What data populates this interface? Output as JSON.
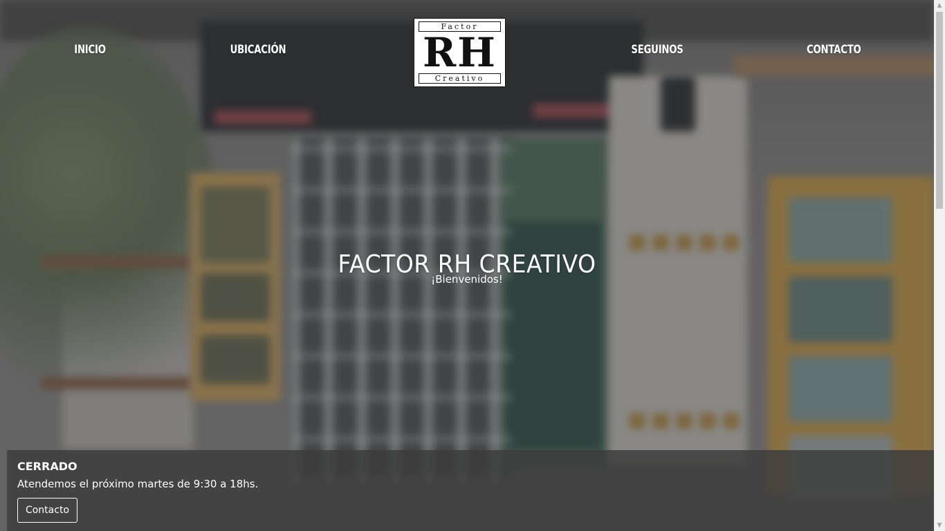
{
  "nav": {
    "items": [
      {
        "label": "INICIO"
      },
      {
        "label": "UBICACIÓN"
      },
      {
        "label": "SEGUINOS"
      },
      {
        "label": "CONTACTO"
      }
    ]
  },
  "logo": {
    "top_text": "Factor",
    "main_text": "RH",
    "bottom_text": "Creativo"
  },
  "hero": {
    "title": "FACTOR RH CREATIVO",
    "subtitle": "¡Bienvenidos!"
  },
  "status": {
    "title": "CERRADO",
    "message": "Atendemos el próximo martes de 9:30 a 18hs.",
    "button_label": "Contacto"
  },
  "colors": {
    "overlay": "#141414",
    "panel": "#3c3c3c",
    "text": "#ffffff"
  },
  "icons": {
    "scroll_up": "triangle-up-icon",
    "scroll_down": "triangle-down-icon"
  }
}
